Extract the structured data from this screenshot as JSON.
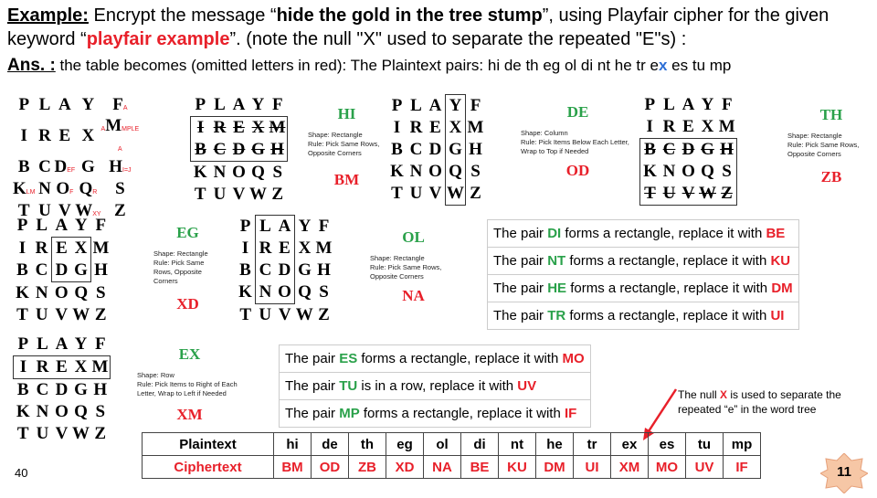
{
  "title": {
    "label": "Example:",
    "text1": " Encrypt the message “",
    "message": "hide the gold in the tree stump",
    "text2": "”, using Playfair cipher for the given keyword “",
    "keyword": "playfair example",
    "text3": "”. (note the null \"X\" used to separate the repeated \"E\"s) :"
  },
  "answer": {
    "label": "Ans. :",
    "text1": " the table becomes (omitted letters in red): The Plaintext pairs: hi de th eg ol di nt he tr e",
    "x": "x",
    "text2": " es tu mp"
  },
  "matrix": [
    [
      "P",
      "L",
      "A",
      "Y",
      "F"
    ],
    [
      "I",
      "R",
      "E",
      "X",
      "M"
    ],
    [
      "B",
      "C",
      "D",
      "G",
      "H"
    ],
    [
      "K",
      "N",
      "O",
      "Q",
      "S"
    ],
    [
      "T",
      "U",
      "V",
      "W",
      "Z"
    ]
  ],
  "annotations": {
    "a1": "A",
    "a2": "A",
    "a3": "MPLE A",
    "a4": "I=J",
    "a5": "EF",
    "a6": "LM",
    "a7": "F",
    "a8": "R",
    "a9": "XY"
  },
  "steps": [
    {
      "pair": "HI",
      "shape": "Shape: Rectangle",
      "rule": "Rule: Pick Same Rows, Opposite Corners",
      "result": "BM"
    },
    {
      "pair": "DE",
      "shape": "Shape: Column",
      "rule": "Rule: Pick Items Below Each Letter, Wrap to Top if Needed",
      "result": "OD"
    },
    {
      "pair": "TH",
      "shape": "Shape: Rectangle",
      "rule": "Rule: Pick Same Rows, Opposite Corners",
      "result": "ZB"
    },
    {
      "pair": "EG",
      "shape": "Shape: Rectangle",
      "rule": "Rule: Pick Same Rows, Opposite Corners",
      "result": "XD"
    },
    {
      "pair": "OL",
      "shape": "Shape: Rectangle",
      "rule": "Rule: Pick Same Rows, Opposite Corners",
      "result": "NA"
    },
    {
      "pair": "EX",
      "shape": "Shape: Row",
      "rule": "Rule: Pick Items to Right of Each Letter, Wrap to Left if Needed",
      "result": "XM"
    }
  ],
  "rules_right": [
    {
      "pre": "The pair ",
      "pair": "DI",
      "mid": " forms a rectangle, replace it with ",
      "res": "BE"
    },
    {
      "pre": "The pair ",
      "pair": "NT",
      "mid": " forms a rectangle, replace it with ",
      "res": "KU"
    },
    {
      "pre": "The pair ",
      "pair": "HE",
      "mid": " forms a rectangle, replace it with ",
      "res": "DM"
    },
    {
      "pre": "The pair ",
      "pair": "TR",
      "mid": " forms a rectangle, replace it with ",
      "res": "UI"
    }
  ],
  "rules_mid": [
    {
      "pre": "The pair ",
      "pair": "ES",
      "mid": " forms a rectangle, replace it with ",
      "res": "MO"
    },
    {
      "pre": "The pair ",
      "pair": "TU",
      "mid": " is in a row, replace it with ",
      "res": "UV"
    },
    {
      "pre": "The pair ",
      "pair": "MP",
      "mid": " forms a rectangle, replace it with ",
      "res": "IF"
    }
  ],
  "null_note": {
    "pre": "The null ",
    "x": "X",
    "post": " is used to separate the repeated “e” in the word tree"
  },
  "table": {
    "plain_label": "Plaintext",
    "cipher_label": "Ciphertext",
    "plain": [
      "hi",
      "de",
      "th",
      "eg",
      "ol",
      "di",
      "nt",
      "he",
      "tr",
      "ex",
      "es",
      "tu",
      "mp"
    ],
    "cipher": [
      "BM",
      "OD",
      "ZB",
      "XD",
      "NA",
      "BE",
      "KU",
      "DM",
      "UI",
      "XM",
      "MO",
      "UV",
      "IF"
    ]
  },
  "page_number": "40",
  "slide_number": "11",
  "colors": {
    "red": "#e8202a",
    "green": "#2aa14a",
    "blue": "#2d6fd6",
    "badge": "#f6c7a6"
  }
}
